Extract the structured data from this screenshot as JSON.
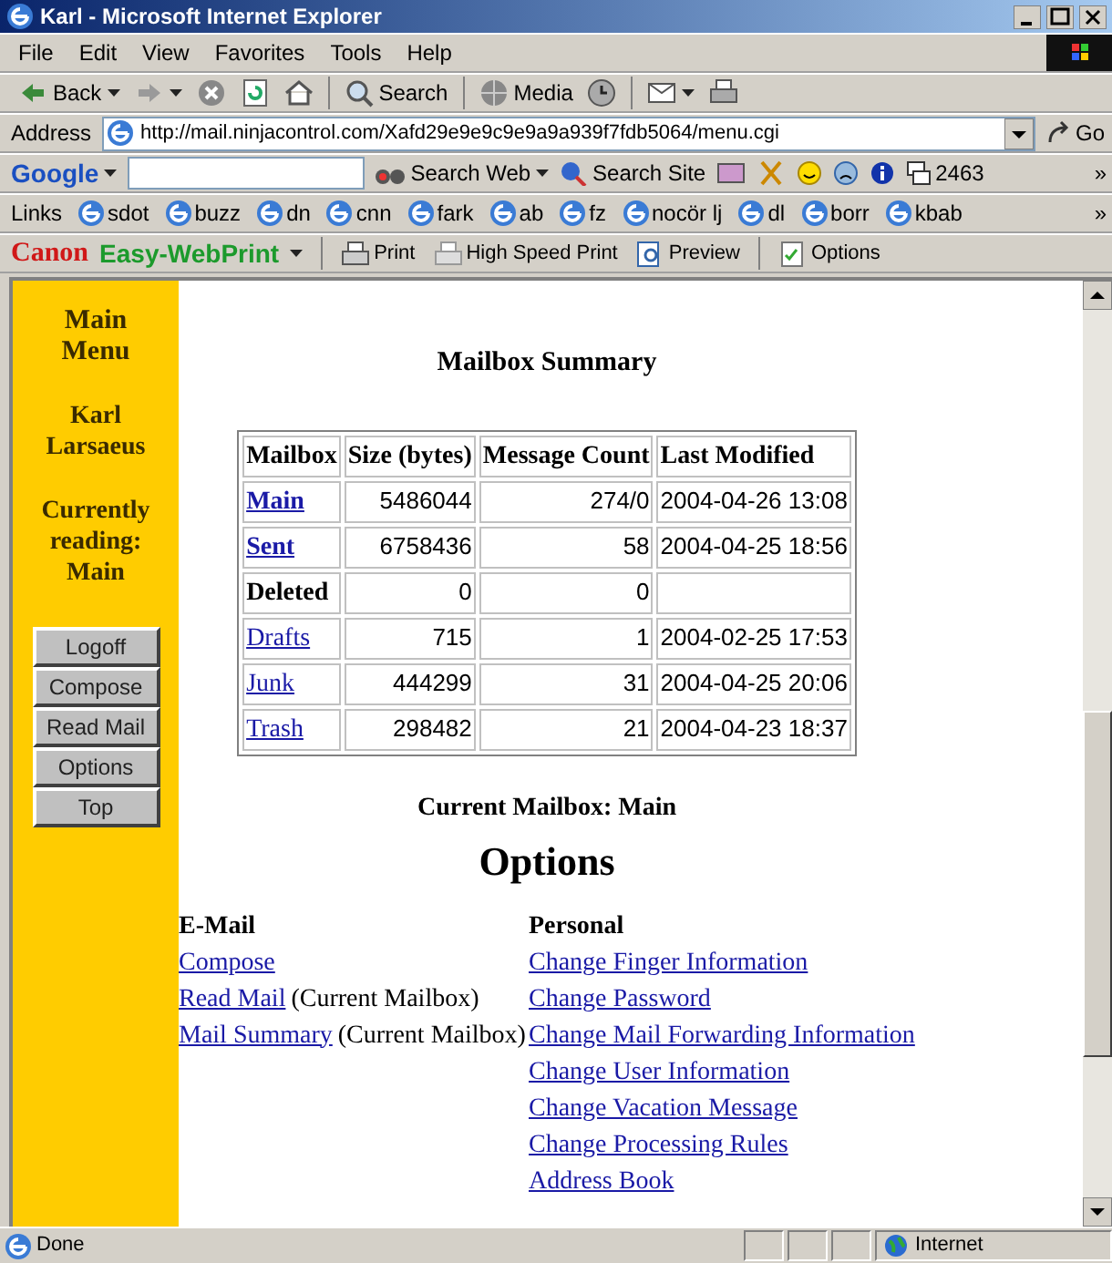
{
  "window": {
    "title": "Karl - Microsoft Internet Explorer"
  },
  "menu_bar": [
    "File",
    "Edit",
    "View",
    "Favorites",
    "Tools",
    "Help"
  ],
  "toolbar": [
    {
      "label": "Back",
      "dropdown": true
    },
    {
      "dropdown": true
    },
    {
      "dropdown": false
    },
    {
      "dropdown": false
    },
    {
      "dropdown": false
    },
    {
      "label": "Search",
      "dropdown": false
    },
    {
      "label": "Media",
      "dropdown": false
    },
    {
      "dropdown": false
    },
    {
      "dropdown": true
    },
    {
      "dropdown": false
    }
  ],
  "address_bar": {
    "label": "Address",
    "url": "http://mail.ninjacontrol.com/Xafd29e9e9c9e9a9a939f7fdb5064/menu.cgi",
    "go": "Go"
  },
  "google_bar": {
    "logo": "Google",
    "search_web": "Search Web",
    "search_site": "Search Site",
    "count": "2463",
    "more": "»"
  },
  "links_bar": {
    "label": "Links",
    "links": [
      "sdot",
      "buzz",
      "dn",
      "cnn",
      "fark",
      "ab",
      "fz",
      "nocör lj",
      "dl",
      "borr",
      "kbab"
    ],
    "more": "»"
  },
  "print_bar": {
    "brand": "Canon",
    "product": "Easy-WebPrint",
    "buttons": [
      "Print",
      "High Speed Print",
      "Preview",
      "Options"
    ]
  },
  "sidebar": {
    "title": "Main Menu",
    "user": "Karl Larsaeus",
    "reading": "Currently reading: Main",
    "buttons": [
      "Logoff",
      "Compose",
      "Read Mail",
      "Options",
      "Top"
    ]
  },
  "summary": {
    "heading": "Mailbox Summary",
    "columns": [
      "Mailbox",
      "Size (bytes)",
      "Message Count",
      "Last Modified"
    ],
    "rows": [
      {
        "name": "Main",
        "link": true,
        "bold": true,
        "size": "5486044",
        "count": "274/0",
        "modified": "2004-04-26 13:08"
      },
      {
        "name": "Sent",
        "link": true,
        "bold": true,
        "size": "6758436",
        "count": "58",
        "modified": "2004-04-25 18:56"
      },
      {
        "name": "Deleted",
        "link": false,
        "bold": true,
        "size": "0",
        "count": "0"
      },
      {
        "name": "Drafts",
        "link": true,
        "bold": false,
        "size": "715",
        "count": "1",
        "modified": "2004-02-25 17:53"
      },
      {
        "name": "Junk",
        "link": true,
        "bold": false,
        "size": "444299",
        "count": "31",
        "modified": "2004-04-25 20:06"
      },
      {
        "name": "Trash",
        "link": true,
        "bold": false,
        "size": "298482",
        "count": "21",
        "modified": "2004-04-23 18:37"
      }
    ]
  },
  "current_mailbox": "Current Mailbox: Main",
  "options": {
    "heading": "Options",
    "email": {
      "heading": "E-Mail",
      "items": [
        {
          "link": "Compose"
        },
        {
          "link": "Read Mail",
          "note": "(Current Mailbox)"
        },
        {
          "link": "Mail Summary",
          "note": "(Current Mailbox)"
        }
      ]
    },
    "personal": {
      "heading": "Personal",
      "items": [
        "Change Finger Information",
        "Change Password",
        "Change Mail Forwarding Information",
        "Change User Information",
        "Change Vacation Message",
        "Change Processing Rules",
        "Address Book"
      ]
    }
  },
  "status_bar": {
    "text": "Done",
    "zone": "Internet"
  }
}
